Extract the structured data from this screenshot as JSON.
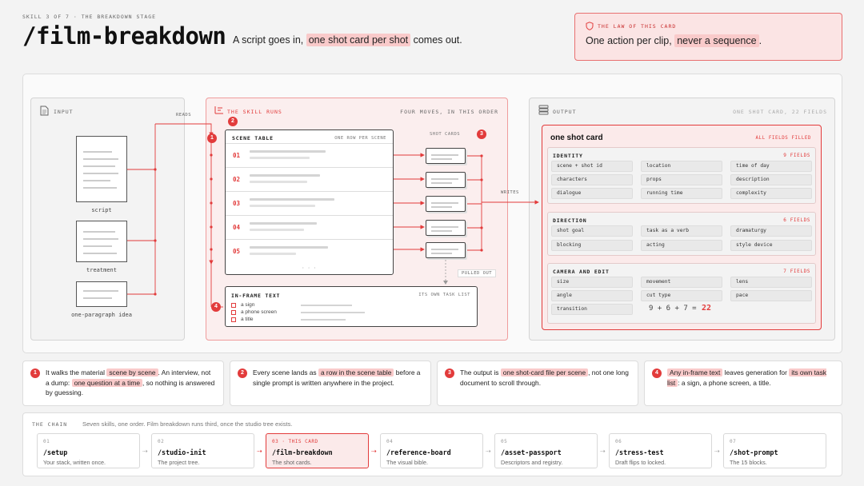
{
  "header": {
    "eyebrow": "SKILL 3 OF 7 · THE BREAKDOWN STAGE",
    "title": "/film-breakdown",
    "tagline_pre": "A script goes in,",
    "tagline_hl": "one shot card per shot",
    "tagline_post": "comes out."
  },
  "law": {
    "eyebrow": "THE LAW OF THIS CARD",
    "text_pre": "One action per clip,",
    "text_hl": "never a sequence",
    "text_post": "."
  },
  "input": {
    "title": "INPUT",
    "docs": [
      {
        "label": "script"
      },
      {
        "label": "treatment"
      },
      {
        "label": "one-paragraph idea"
      }
    ],
    "reads_label": "READS"
  },
  "skill": {
    "title": "THE SKILL RUNS",
    "subtitle": "FOUR MOVES, IN THIS ORDER",
    "badges": [
      "1",
      "2",
      "3",
      "4"
    ],
    "scene_table": {
      "title": "SCENE TABLE",
      "subtitle": "ONE ROW PER SCENE",
      "rows": [
        "01",
        "02",
        "03",
        "04",
        "05"
      ],
      "ellipsis": "· · ·"
    },
    "shot_cards_label": "SHOT CARDS",
    "pulled_out_label": "PULLED OUT",
    "writes_label": "WRITES",
    "inframe": {
      "title": "IN-FRAME TEXT",
      "subtitle": "ITS OWN TASK LIST",
      "items": [
        "a sign",
        "a phone screen",
        "a title"
      ]
    }
  },
  "output": {
    "title": "OUTPUT",
    "subtitle": "ONE SHOT CARD, 22 FIELDS",
    "card": {
      "title": "one shot card",
      "status": "ALL FIELDS FILLED",
      "groups": [
        {
          "name": "IDENTITY",
          "count": "9 FIELDS",
          "fields": [
            "scene + shot id",
            "location",
            "time of day",
            "characters",
            "props",
            "description",
            "dialogue",
            "running time",
            "complexity"
          ]
        },
        {
          "name": "DIRECTION",
          "count": "6 FIELDS",
          "fields": [
            "shot goal",
            "task as a verb",
            "dramaturgy",
            "blocking",
            "acting",
            "style device"
          ]
        },
        {
          "name": "CAMERA AND EDIT",
          "count": "7 FIELDS",
          "fields": [
            "size",
            "movement",
            "lens",
            "angle",
            "cut type",
            "pace",
            "transition"
          ]
        }
      ],
      "sum_expr": "9 + 6 + 7 =",
      "sum_total": "22"
    }
  },
  "notes": [
    {
      "n": "1",
      "parts": [
        "It walks the material ",
        "scene by scene",
        ". An interview, not a dump: ",
        "one question at a time",
        ", so nothing is answered by guessing."
      ]
    },
    {
      "n": "2",
      "parts": [
        "Every scene lands as ",
        "a row in the scene table",
        " before a single prompt is written anywhere in the project."
      ]
    },
    {
      "n": "3",
      "parts": [
        "The output is ",
        "one shot-card file per scene",
        ", not one long document to scroll through."
      ]
    },
    {
      "n": "4",
      "parts": [
        "",
        "Any in-frame text",
        " leaves generation for ",
        "its own task list",
        ": a sign, a phone screen, a title."
      ]
    }
  ],
  "chain": {
    "label": "THE CHAIN",
    "description": "Seven skills, one order. Film breakdown runs third, once the studio tree exists.",
    "steps": [
      {
        "idx": "01",
        "cmd": "/setup",
        "desc": "Your stack, written once."
      },
      {
        "idx": "02",
        "cmd": "/studio-init",
        "desc": "The project tree."
      },
      {
        "idx": "03 · THIS CARD",
        "cmd": "/film-breakdown",
        "desc": "The shot cards."
      },
      {
        "idx": "04",
        "cmd": "/reference-board",
        "desc": "The visual bible."
      },
      {
        "idx": "05",
        "cmd": "/asset-passport",
        "desc": "Descriptors and registry."
      },
      {
        "idx": "06",
        "cmd": "/stress-test",
        "desc": "Draft flips to locked."
      },
      {
        "idx": "07",
        "cmd": "/shot-prompt",
        "desc": "The 15 blocks."
      }
    ]
  },
  "colors": {
    "accent": "#e23b3b",
    "accent_soft": "#f9caca",
    "panel_pink": "#fbeeee"
  }
}
